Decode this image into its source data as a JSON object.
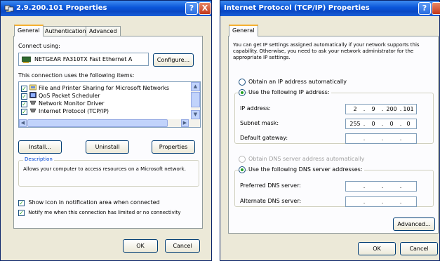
{
  "left_window": {
    "title": "2.9.200.101 Properties",
    "help_glyph": "?",
    "close_glyph": "X",
    "tabs": [
      "General",
      "Authentication",
      "Advanced"
    ],
    "connect_using_label": "Connect using:",
    "adapter_name": "NETGEAR FA310TX Fast Ethernet A",
    "configure_button": "Configure...",
    "components_label": "This connection uses the following items:",
    "components": [
      "File and Printer Sharing for Microsoft Networks",
      "QoS Packet Scheduler",
      "Network Monitor Driver",
      "Internet Protocol (TCP/IP)"
    ],
    "install_button": "Install...",
    "uninstall_button": "Uninstall",
    "properties_button": "Properties",
    "description_label": "Description",
    "description_text": "Allows your computer to access resources on a Microsoft network.",
    "show_icon_label": "Show icon in notification area when connected",
    "notify_label": "Notify me when this connection has limited or no connectivity",
    "ok_button": "OK",
    "cancel_button": "Cancel"
  },
  "right_window": {
    "title": "Internet Protocol (TCP/IP) Properties",
    "help_glyph": "?",
    "tab_general": "General",
    "intro_text": "You can get IP settings assigned automatically if your network supports this capability. Otherwise, you need to ask your network administrator for the appropriate IP settings.",
    "obtain_ip_auto": "Obtain an IP address automatically",
    "use_following_ip": "Use the following IP address:",
    "ip_address_label": "IP address:",
    "ip_address": [
      "2",
      "9",
      "200",
      "101"
    ],
    "subnet_mask_label": "Subnet mask:",
    "subnet_mask": [
      "255",
      "0",
      "0",
      "0"
    ],
    "default_gateway_label": "Default gateway:",
    "obtain_dns_auto": "Obtain DNS server address automatically",
    "use_following_dns": "Use the following DNS server addresses:",
    "preferred_dns_label": "Preferred DNS server:",
    "alternate_dns_label": "Alternate DNS server:",
    "advanced_button": "Advanced...",
    "ok_button": "OK",
    "cancel_button": "Cancel"
  },
  "colors": {
    "titlebar": "#0a55d8",
    "dialog_bg": "#ece9d8",
    "panel_bg": "#fcfcfe",
    "group_label": "#0046d5",
    "check_green": "#21a121"
  }
}
